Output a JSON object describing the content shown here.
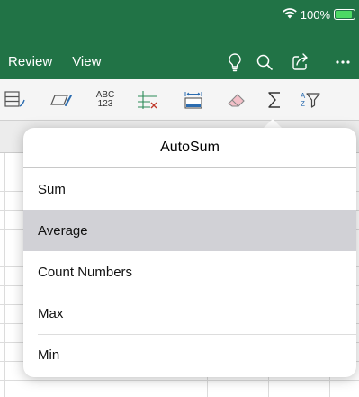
{
  "status": {
    "battery": "100%",
    "battery_level": 1.0
  },
  "header": {
    "tabs": [
      "Review",
      "View"
    ]
  },
  "toolbar": {
    "abc_top": "ABC",
    "abc_bottom": "123",
    "sort_a": "A",
    "sort_z": "Z"
  },
  "autosum": {
    "title": "AutoSum",
    "items": [
      {
        "label": "Sum"
      },
      {
        "label": "Average",
        "selected": true
      },
      {
        "label": "Count Numbers"
      },
      {
        "label": "Max"
      },
      {
        "label": "Min"
      }
    ]
  },
  "colors": {
    "header": "#217346",
    "selection": "#d1d1d6",
    "battery": "#4cd964"
  }
}
